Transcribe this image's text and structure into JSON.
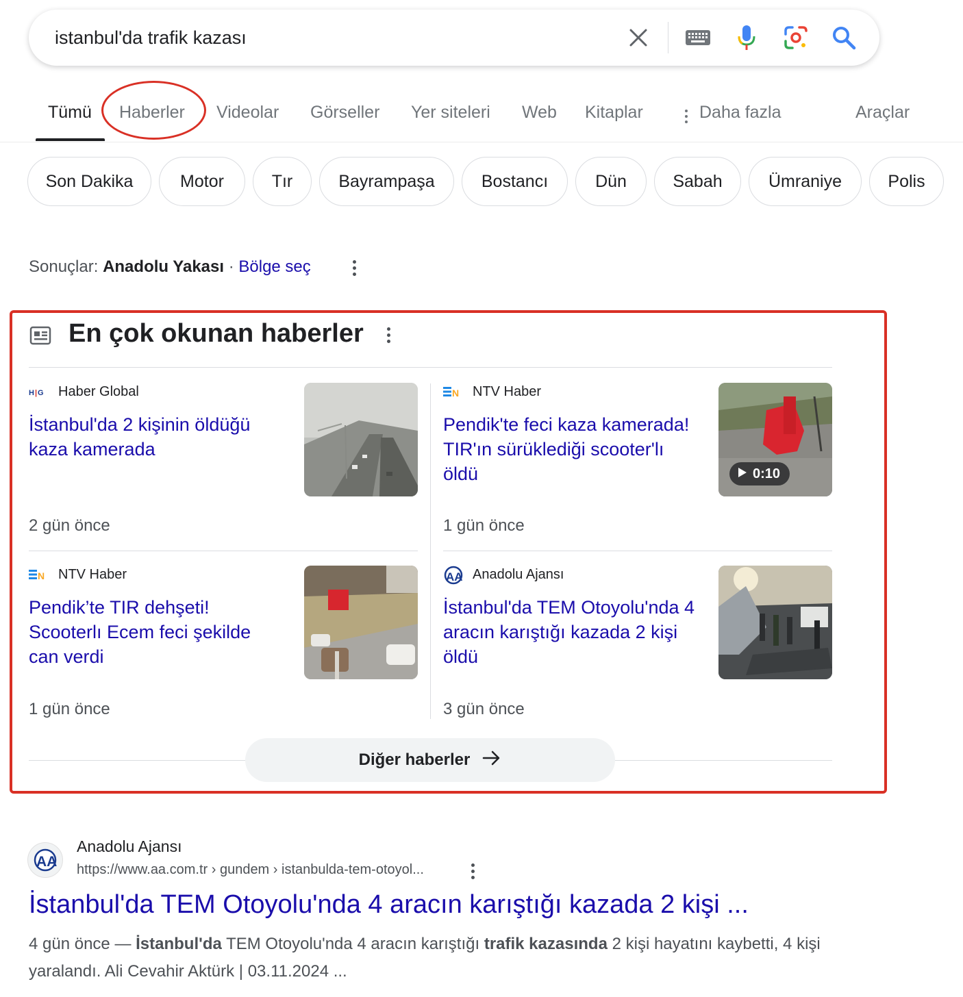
{
  "search": {
    "query": "istanbul'da trafik kazası",
    "icons": [
      "close-icon",
      "keyboard-icon",
      "microphone-icon",
      "lens-icon",
      "search-icon"
    ]
  },
  "tabs": [
    {
      "label": "Tümü",
      "active": true
    },
    {
      "label": "Haberler",
      "active": false,
      "annotated": true
    },
    {
      "label": "Videolar",
      "active": false
    },
    {
      "label": "Görseller",
      "active": false
    },
    {
      "label": "Yer siteleri",
      "active": false
    },
    {
      "label": "Web",
      "active": false
    },
    {
      "label": "Kitaplar",
      "active": false
    },
    {
      "label": "Daha fazla",
      "active": false
    },
    {
      "label": "Araçlar",
      "active": false
    }
  ],
  "chips": [
    "Son Dakika",
    "Motor",
    "Tır",
    "Bayrampaşa",
    "Bostancı",
    "Dün",
    "Sabah",
    "Ümraniye",
    "Polis"
  ],
  "region": {
    "label": "Sonuçlar:",
    "value": "Anadolu Yakası",
    "separator": "·",
    "link": "Bölge seç"
  },
  "top_stories": {
    "title": "En çok okunan haberler",
    "items": [
      {
        "source": "Haber Global",
        "source_logo": "haber-global-logo",
        "headline": "İstanbul'da 2 kişinin öldüğü kaza kamerada",
        "age": "2 gün önce"
      },
      {
        "source": "NTV Haber",
        "source_logo": "ntv-logo",
        "headline": "Pendik'te feci kaza kamerada! TIR'ın sürüklediği scooter'lı öldü",
        "age": "1 gün önce",
        "video_duration": "0:10"
      },
      {
        "source": "NTV Haber",
        "source_logo": "ntv-logo",
        "headline": "Pendik’te TIR dehşeti! Scooterlı Ecem feci şekilde can verdi",
        "age": "1 gün önce"
      },
      {
        "source": "Anadolu Ajansı",
        "source_logo": "aa-logo",
        "headline": "İstanbul'da TEM Otoyolu'nda 4 aracın karıştığı kazada 2 kişi öldü",
        "age": "3 gün önce"
      }
    ],
    "more_label": "Diğer haberler"
  },
  "result": {
    "site": "Anadolu Ajansı",
    "url": "https://www.aa.com.tr › gundem › istanbulda-tem-otoyol...",
    "title": "İstanbul'da TEM Otoyolu'nda 4 aracın karıştığı kazada 2 kişi ...",
    "snippet": {
      "age": "4 gün önce",
      "dash": " — ",
      "b1": "İstanbul'da",
      "t1": " TEM Otoyolu'nda 4 aracın karıştığı ",
      "b2": "trafik kazasında",
      "t2": " 2 kişi hayatını kaybetti, 4 kişi yaralandı. Ali Cevahir Aktürk | 03.11.2024 ..."
    }
  },
  "colors": {
    "link": "#1a0dab",
    "annotation": "#d93025",
    "google_blue": "#4285f4"
  }
}
